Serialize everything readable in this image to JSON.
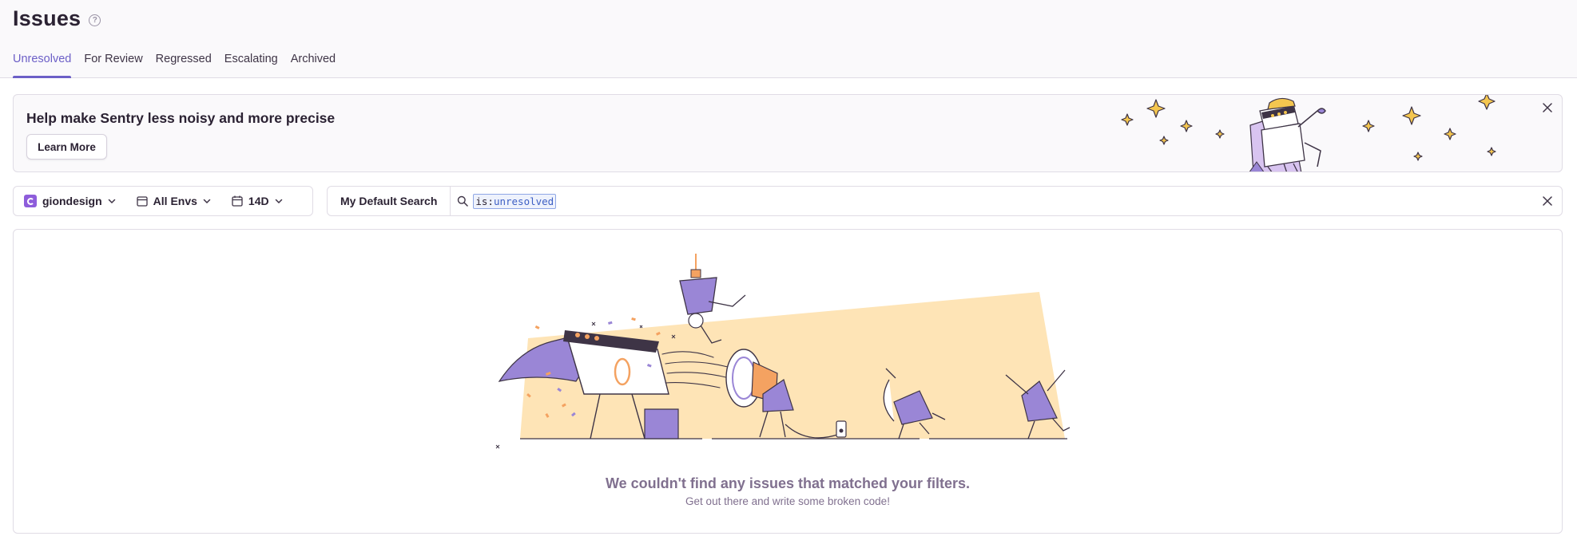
{
  "header": {
    "title": "Issues",
    "tabs": [
      {
        "label": "Unresolved",
        "active": true
      },
      {
        "label": "For Review"
      },
      {
        "label": "Regressed"
      },
      {
        "label": "Escalating"
      },
      {
        "label": "Archived"
      }
    ]
  },
  "banner": {
    "title": "Help make Sentry less noisy and more precise",
    "button": "Learn More"
  },
  "filters": {
    "project": "giondesign",
    "environment": "All Envs",
    "date_range": "14D"
  },
  "search": {
    "saved_search": "My Default Search",
    "query_key": "is:",
    "query_value": "unresolved"
  },
  "empty_state": {
    "title": "We couldn't find any issues that matched your filters.",
    "subtitle": "Get out there and write some broken code!"
  },
  "colors": {
    "accent": "#6c5fc7",
    "illustration_bg": "#fee4b6",
    "illustration_purple": "#9a86d6"
  }
}
